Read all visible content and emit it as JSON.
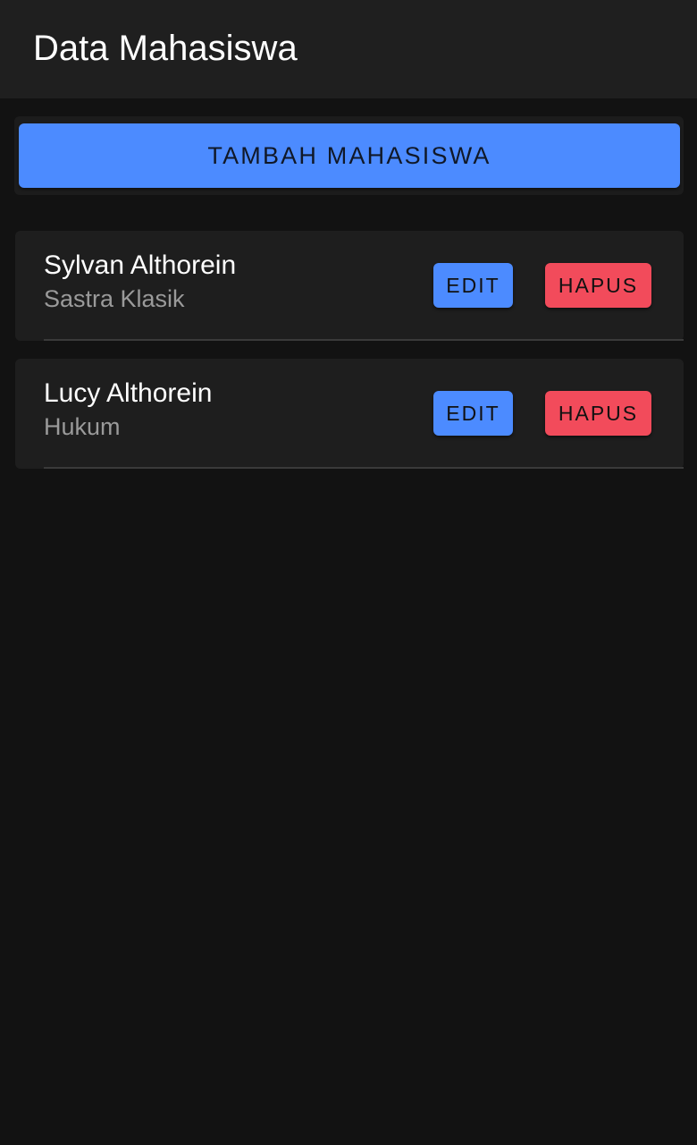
{
  "app_bar": {
    "title": "Data Mahasiswa"
  },
  "add_button": {
    "label": "TAMBAH MAHASISWA"
  },
  "students": [
    {
      "name": "Sylvan Althorein",
      "major": "Sastra Klasik",
      "edit_label": "EDIT",
      "delete_label": "HAPUS"
    },
    {
      "name": "Lucy Althorein",
      "major": "Hukum",
      "edit_label": "EDIT",
      "delete_label": "HAPUS"
    }
  ],
  "colors": {
    "primary": "#4c8bff",
    "danger": "#f24b5b",
    "background": "#121212",
    "surface": "#1e1e1e"
  }
}
